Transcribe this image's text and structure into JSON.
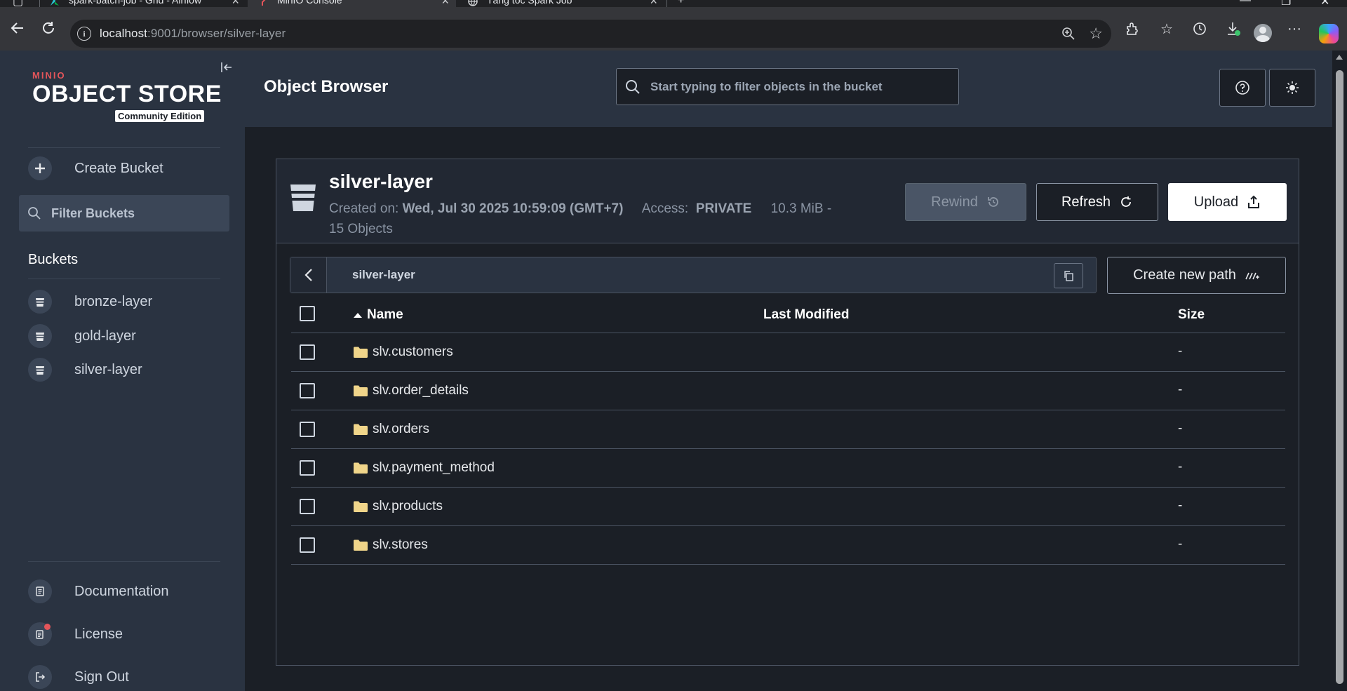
{
  "browser": {
    "tabs": [
      {
        "title": "spark-batch-job - Grid - Airflow"
      },
      {
        "title": "MinIO Console"
      },
      {
        "title": "Tăng tốc Spark Job"
      }
    ],
    "url_host": "localhost",
    "url_rest": ":9001/browser/silver-layer"
  },
  "sidebar": {
    "logo_brand": "MINIO",
    "logo_title": "OBJECT STORE",
    "logo_edition": "Community Edition",
    "create_bucket": "Create Bucket",
    "filter_placeholder": "Filter Buckets",
    "buckets_title": "Buckets",
    "buckets": [
      "bronze-layer",
      "gold-layer",
      "silver-layer"
    ],
    "footer": [
      "Documentation",
      "License",
      "Sign Out"
    ]
  },
  "header": {
    "title": "Object Browser",
    "search_placeholder": "Start typing to filter objects in the bucket"
  },
  "bucket": {
    "name": "silver-layer",
    "created_label": "Created on:",
    "created_value": "Wed, Jul 30 2025 10:59:09 (GMT+7)",
    "access_label": "Access:",
    "access_value": "PRIVATE",
    "size_info": "10.3 MiB -",
    "objects_info": "15 Objects",
    "rewind_label": "Rewind",
    "refresh_label": "Refresh",
    "upload_label": "Upload"
  },
  "path": {
    "crumb": "silver-layer",
    "create_new_path": "Create new path"
  },
  "table": {
    "columns": {
      "name": "Name",
      "modified": "Last Modified",
      "size": "Size"
    },
    "rows": [
      {
        "name": "slv.customers",
        "size": "-"
      },
      {
        "name": "slv.order_details",
        "size": "-"
      },
      {
        "name": "slv.orders",
        "size": "-"
      },
      {
        "name": "slv.payment_method",
        "size": "-"
      },
      {
        "name": "slv.products",
        "size": "-"
      },
      {
        "name": "slv.stores",
        "size": "-"
      }
    ]
  },
  "colors": {
    "sidebar_bg": "#2a3341",
    "main_bg": "#1b1f26",
    "brand_red": "#e4555a",
    "folder": "#f0d58a"
  }
}
